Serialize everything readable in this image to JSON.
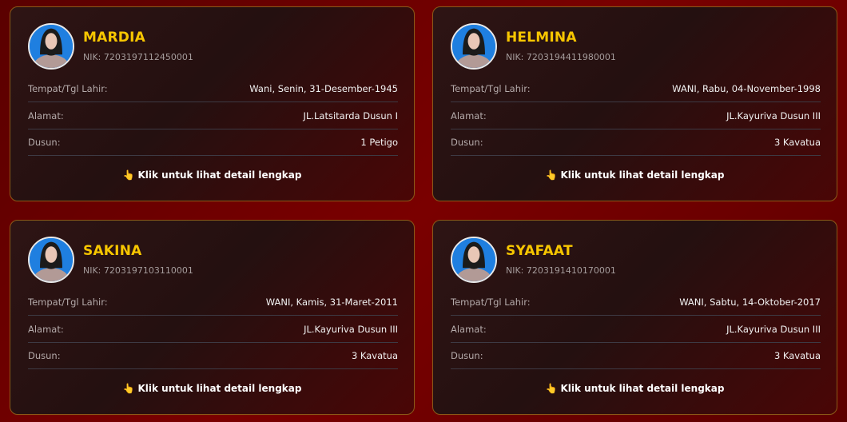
{
  "labels": {
    "birth": "Tempat/Tgl Lahir:",
    "address": "Alamat:",
    "hamlet": "Dusun:",
    "cta_icon": "👆",
    "cta": "Klik untuk lihat detail lengkap"
  },
  "cards": [
    {
      "name": "MARDIA",
      "nik": "NIK: 7203197112450001",
      "birth": "Wani, Senin, 31-Desember-1945",
      "address": "JL.Latsitarda Dusun I",
      "hamlet": "1 Petigo"
    },
    {
      "name": "HELMINA",
      "nik": "NIK: 7203194411980001",
      "birth": "WANI, Rabu, 04-November-1998",
      "address": "JL.Kayuriva Dusun III",
      "hamlet": "3 Kavatua"
    },
    {
      "name": "SAKINA",
      "nik": "NIK: 7203197103110001",
      "birth": "WANI, Kamis, 31-Maret-2011",
      "address": "JL.Kayuriva Dusun III",
      "hamlet": "3 Kavatua"
    },
    {
      "name": "SYAFAAT",
      "nik": "NIK: 7203191410170001",
      "birth": "WANI, Sabtu, 14-Oktober-2017",
      "address": "JL.Kayuriva Dusun III",
      "hamlet": "3 Kavatua"
    }
  ],
  "colors": {
    "name": "#f7c600",
    "card_border": "#8a5a18",
    "avatar_background": "#1f7fe0"
  },
  "icons": {
    "avatar": "female-hijab-avatar-icon",
    "cta": "pointing-hand-icon"
  }
}
